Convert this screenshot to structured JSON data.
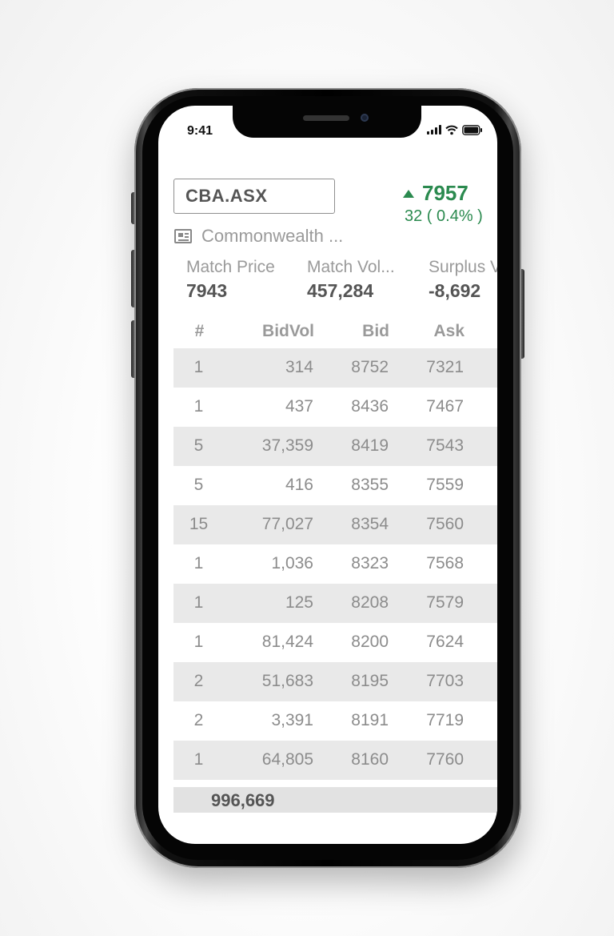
{
  "status_bar": {
    "time": "9:41"
  },
  "quote": {
    "symbol": "CBA.ASX",
    "last_price": "7957",
    "change": "32 ( 0.4% )",
    "company_name": "Commonwealth ...",
    "direction": "up",
    "up_color": "#2b8a4f"
  },
  "stats": [
    {
      "label": "Match Price",
      "value": "7943"
    },
    {
      "label": "Match Vol...",
      "value": "457,284"
    },
    {
      "label": "Surplus V...",
      "value": "-8,692"
    }
  ],
  "depth_table": {
    "columns": [
      "#",
      "BidVol",
      "Bid",
      "Ask"
    ],
    "rows": [
      {
        "num": "1",
        "bidvol": "314",
        "bid": "8752",
        "ask": "7321"
      },
      {
        "num": "1",
        "bidvol": "437",
        "bid": "8436",
        "ask": "7467"
      },
      {
        "num": "5",
        "bidvol": "37,359",
        "bid": "8419",
        "ask": "7543"
      },
      {
        "num": "5",
        "bidvol": "416",
        "bid": "8355",
        "ask": "7559"
      },
      {
        "num": "15",
        "bidvol": "77,027",
        "bid": "8354",
        "ask": "7560"
      },
      {
        "num": "1",
        "bidvol": "1,036",
        "bid": "8323",
        "ask": "7568"
      },
      {
        "num": "1",
        "bidvol": "125",
        "bid": "8208",
        "ask": "7579"
      },
      {
        "num": "1",
        "bidvol": "81,424",
        "bid": "8200",
        "ask": "7624"
      },
      {
        "num": "2",
        "bidvol": "51,683",
        "bid": "8195",
        "ask": "7703"
      },
      {
        "num": "2",
        "bidvol": "3,391",
        "bid": "8191",
        "ask": "7719"
      },
      {
        "num": "1",
        "bidvol": "64,805",
        "bid": "8160",
        "ask": "7760"
      }
    ],
    "total_bidvol": "996,669"
  }
}
